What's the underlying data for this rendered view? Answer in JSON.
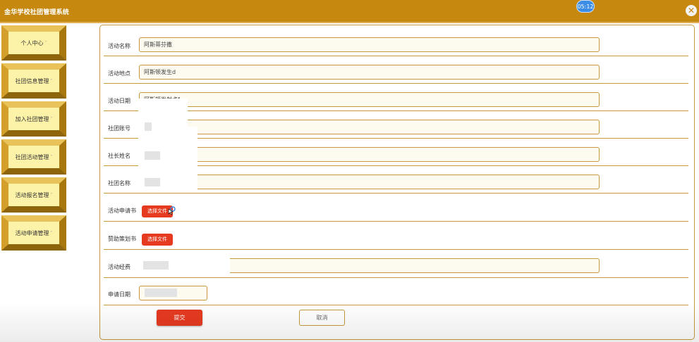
{
  "app": {
    "title": "金华学校社团管理系统",
    "clock": "05:12",
    "close_icon": "close-x-icon"
  },
  "sidebar": {
    "items": [
      {
        "label": "个人中心"
      },
      {
        "label": "社团信息管理"
      },
      {
        "label": "加入社团管理"
      },
      {
        "label": "社团活动管理"
      },
      {
        "label": "活动报名管理"
      },
      {
        "label": "活动申请管理"
      }
    ],
    "caret": "˅"
  },
  "form": {
    "fields": [
      {
        "label": "活动名称",
        "value": "阿斯蒂芬撒"
      },
      {
        "label": "活动地点",
        "value": "阿斯顿发生d"
      },
      {
        "label": "活动日期",
        "value": "阿斯顿发射点f"
      },
      {
        "label": "社团账号",
        "value": ""
      },
      {
        "label": "社长姓名",
        "value": ""
      },
      {
        "label": "社团名称",
        "value": ""
      },
      {
        "label": "活动申请书",
        "button": "选择文件"
      },
      {
        "label": "赞助策划书",
        "button": "选择文件"
      },
      {
        "label": "活动经费",
        "value": ""
      },
      {
        "label": "申请日期",
        "value": ""
      }
    ],
    "submit": "提交",
    "cancel": "取消"
  },
  "colors": {
    "topbar": "#c6880f",
    "accent_red": "#e53a20",
    "border": "#c59a3b",
    "clock": "#3b8de6"
  }
}
